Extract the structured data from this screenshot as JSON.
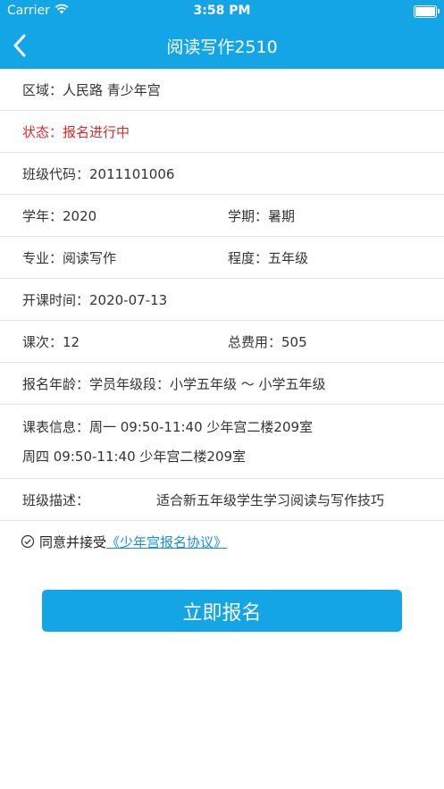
{
  "status_bar": {
    "carrier": "Carrier",
    "time": "3:58 PM"
  },
  "nav": {
    "title": "阅读写作2510"
  },
  "details": {
    "region": "区域：人民路 青少年宫",
    "status": "状态：报名进行中",
    "class_code": "班级代码：2011101006",
    "year": "学年：2020",
    "term": "学期：暑期",
    "major": "专业：阅读写作",
    "level": "程度：五年级",
    "start_date": "开课时间：2020-07-13",
    "sessions": "课次：12",
    "total_fee": "总费用：505",
    "age": "报名年龄：学员年级段：小学五年级 ～ 小学五年级",
    "schedule_line1": "课表信息：周一 09:50-11:40 少年宫二楼209室",
    "schedule_line2": "周四 09:50-11:40 少年宫二楼209室",
    "desc_label": "班级描述：",
    "desc_value": "适合新五年级学生学习阅读与写作技巧"
  },
  "agreement": {
    "text": "同意并接受",
    "link": "《少年宫报名协议》"
  },
  "submit_label": "立即报名",
  "colors": {
    "brand": "#14a5e6",
    "status_red": "#e0282b",
    "link": "#1a8fd8"
  }
}
